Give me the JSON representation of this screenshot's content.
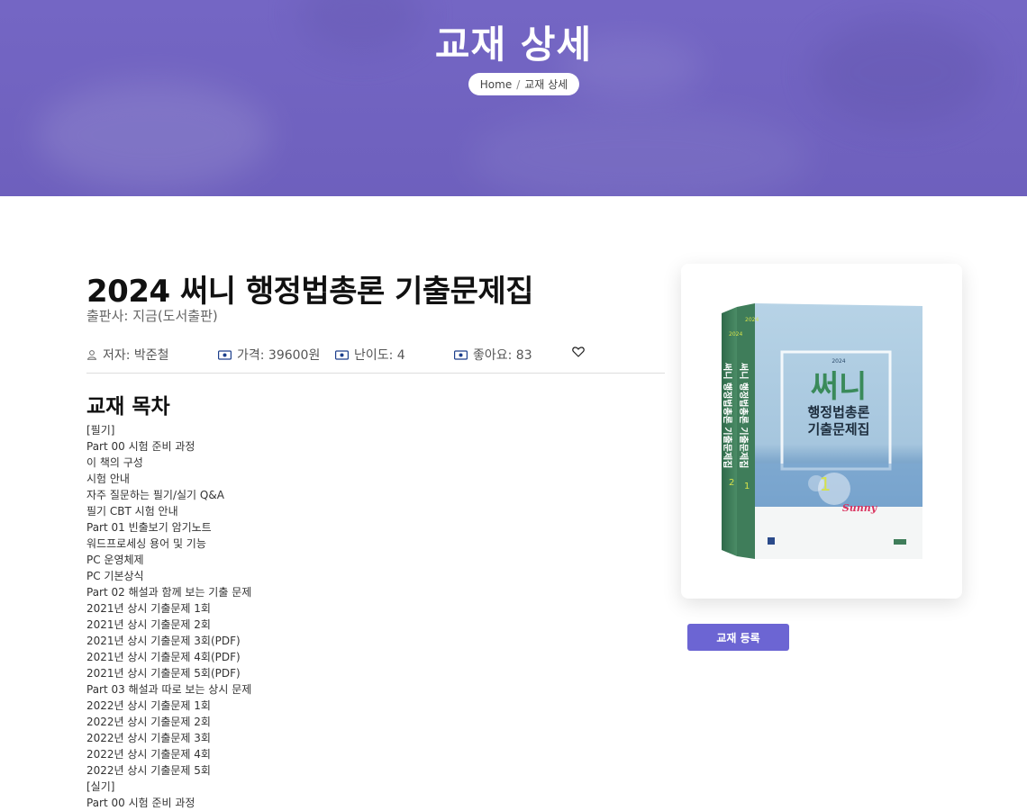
{
  "hero": {
    "title": "교재 상세",
    "breadcrumb": {
      "home": "Home",
      "separator": "/",
      "current": "교재 상세"
    }
  },
  "book": {
    "title": "2024 써니 행정법총론 기출문제집",
    "publisher": "출판사: 지금(도서출판)",
    "author": "저자: 박준철",
    "price": "가격: 39600원",
    "difficulty": "난이도: 4",
    "likes": "좋아요: 83"
  },
  "toc": {
    "heading": "교재 목차",
    "items": [
      "[필기]",
      "Part 00 시험 준비 과정",
      "이 책의 구성",
      "시험 안내",
      "자주 질문하는 필기/실기 Q&A",
      "필기 CBT 시험 안내",
      "Part 01 빈출보기 암기노트",
      "워드프로세싱 용어 및 기능",
      "PC 운영체제",
      "PC 기본상식",
      "Part 02 해설과 함께 보는 기출 문제",
      "2021년 상시 기출문제 1회",
      "2021년 상시 기출문제 2회",
      "2021년 상시 기출문제 3회(PDF)",
      "2021년 상시 기출문제 4회(PDF)",
      "2021년 상시 기출문제 5회(PDF)",
      "Part 03 해설과 따로 보는 상시 문제",
      "2022년 상시 기출문제 1회",
      "2022년 상시 기출문제 2회",
      "2022년 상시 기출문제 3회",
      "2022년 상시 기출문제 4회",
      "2022년 상시 기출문제 5회",
      "[실기]",
      "Part 00 시험 준비 과정"
    ]
  },
  "cover": {
    "year": "2024",
    "brand": "써니",
    "title_line1": "행정법총론",
    "title_line2": "기출문제집",
    "volume": "1",
    "volume2": "2",
    "series": "Sunny",
    "colors": {
      "spine": "#3f7d5a",
      "sky": "#9fc3dd",
      "sea": "#6f9fc8",
      "accent": "#d6e24a"
    }
  },
  "actions": {
    "register": "교재 등록"
  },
  "icons": {
    "author": "user-icon",
    "price": "money-icon",
    "difficulty": "money-icon",
    "likes": "money-icon",
    "heart": "heart-icon"
  },
  "colors": {
    "hero": "#7062c0",
    "button": "#6c65d3"
  }
}
